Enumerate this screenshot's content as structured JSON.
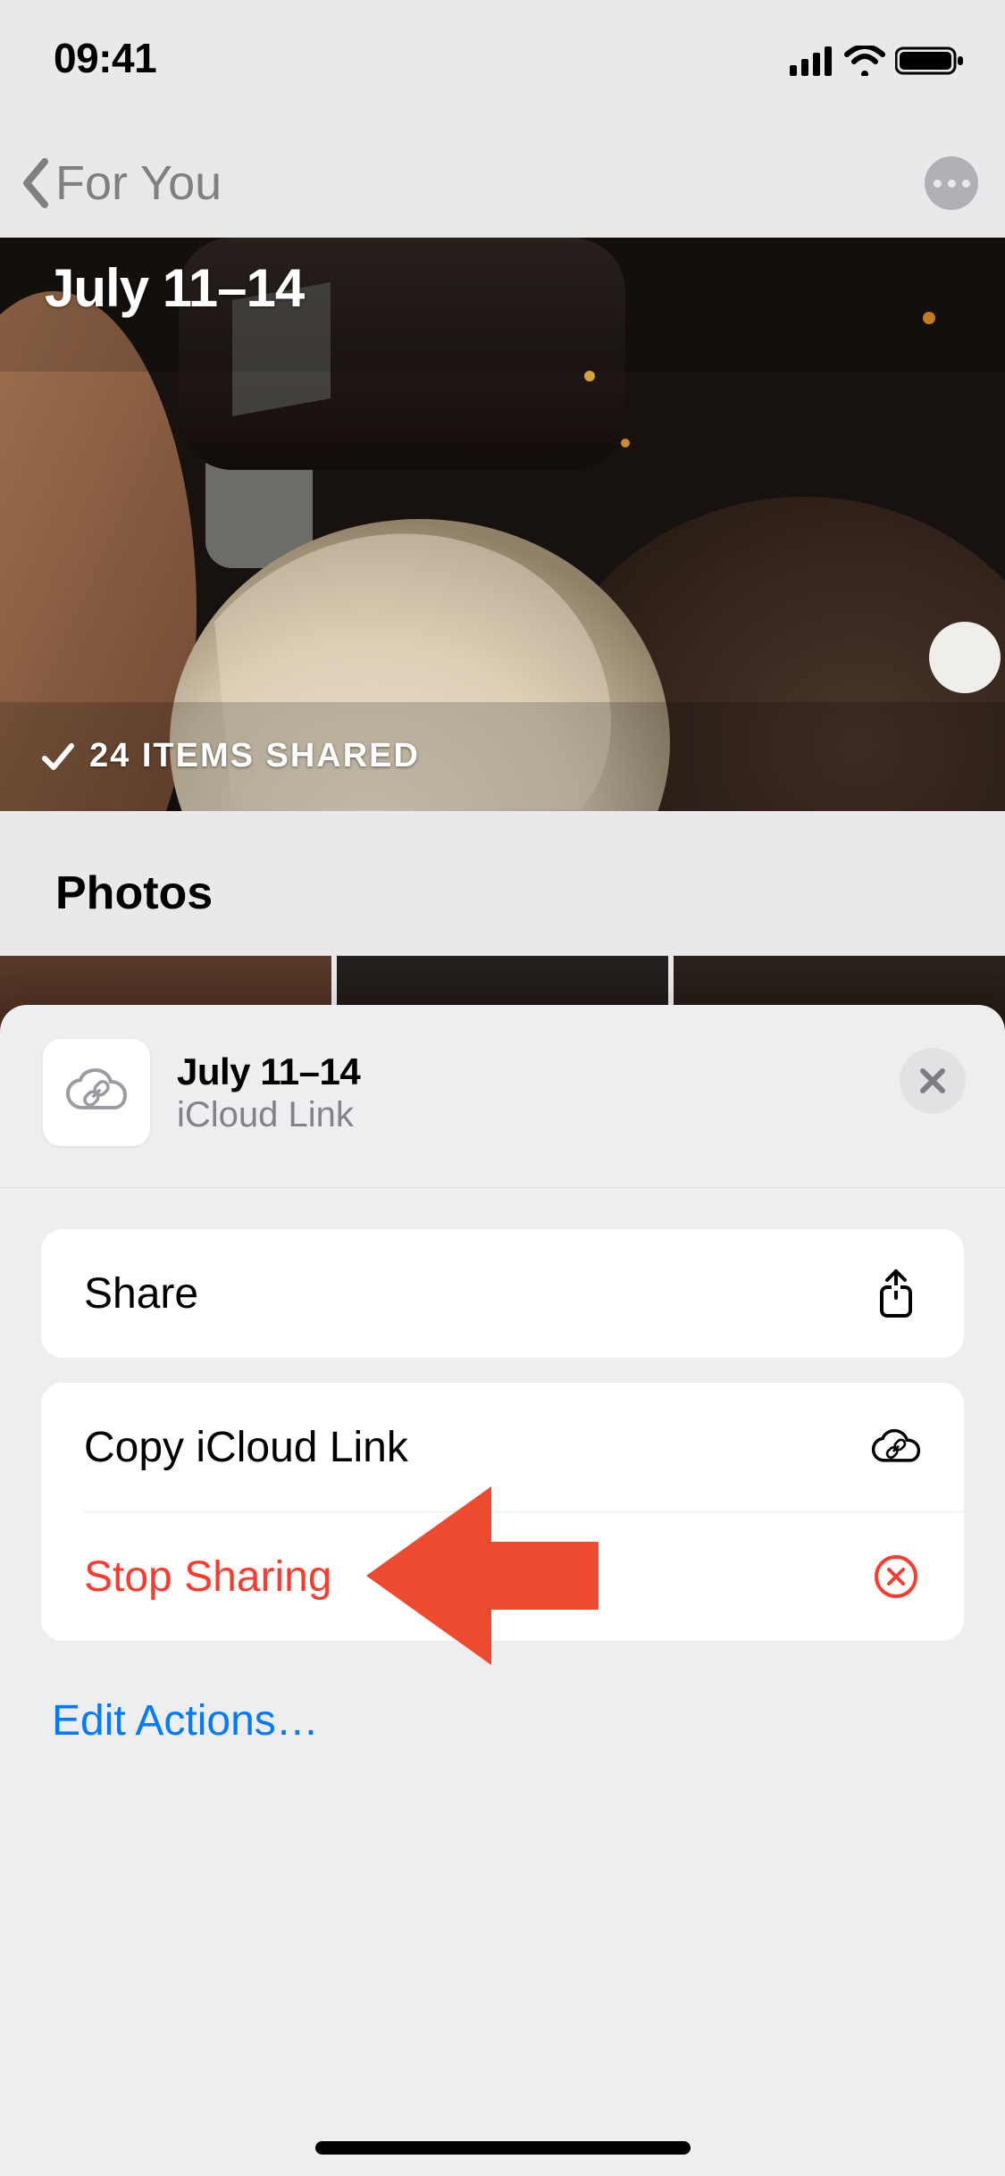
{
  "status": {
    "time": "09:41"
  },
  "nav": {
    "back_label": "For You"
  },
  "hero": {
    "title": "July 11–14",
    "shared_text": "24 ITEMS SHARED"
  },
  "section": {
    "title": "Photos"
  },
  "sheet": {
    "title": "July 11–14",
    "subtitle": "iCloud Link",
    "actions": {
      "share": "Share",
      "copy_link": "Copy iCloud Link",
      "stop_sharing": "Stop Sharing",
      "edit_actions": "Edit Actions…"
    }
  },
  "colors": {
    "destructive": "#ff3b30",
    "link": "#007aff"
  }
}
